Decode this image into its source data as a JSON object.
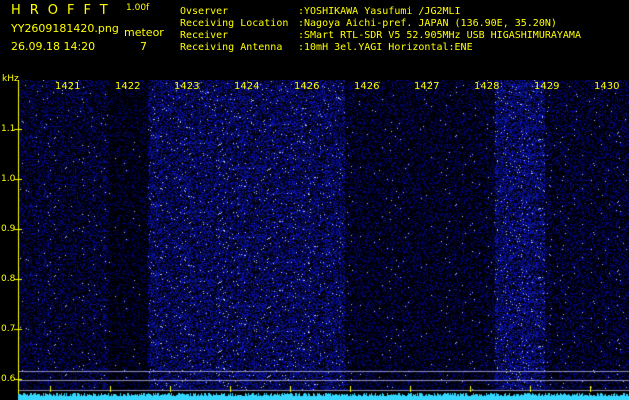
{
  "header": {
    "brand": "HROFFT",
    "version": "1.00f",
    "filename": "YY2609181420.png",
    "datetime": "26.09.18 14:20",
    "meteor_label": "meteor",
    "meteor_count": "7",
    "info": [
      {
        "label": "Ovserver",
        "value": ":YOSHIKAWA Yasufumi /JG2MLI"
      },
      {
        "label": "Receiving Location",
        "value": ":Nagoya Aichi-pref. JAPAN (136.90E, 35.20N)"
      },
      {
        "label": "Receiver",
        "value": ":SMart RTL-SDR V5 52.905MHz USB HIGASHIMURAYAMA"
      },
      {
        "label": "Receiving Antenna",
        "value": ":10mH 3el.YAGI Horizontal:ENE"
      }
    ]
  },
  "spectrogram": {
    "y_unit": "kHz",
    "y_ticks": [
      "1.1",
      "1.0",
      "0.9",
      "0.8",
      "0.7",
      "0.6"
    ],
    "minute_labels": [
      "1421",
      "1422",
      "1423",
      "1424",
      "1426",
      "1426",
      "1427",
      "1428",
      "1429",
      "1430"
    ],
    "colors": {
      "background": "#000000",
      "noise": "#1a22c8",
      "baseline": "#35d6ff",
      "label": "#ffff00",
      "text": "#58e27a"
    }
  }
}
